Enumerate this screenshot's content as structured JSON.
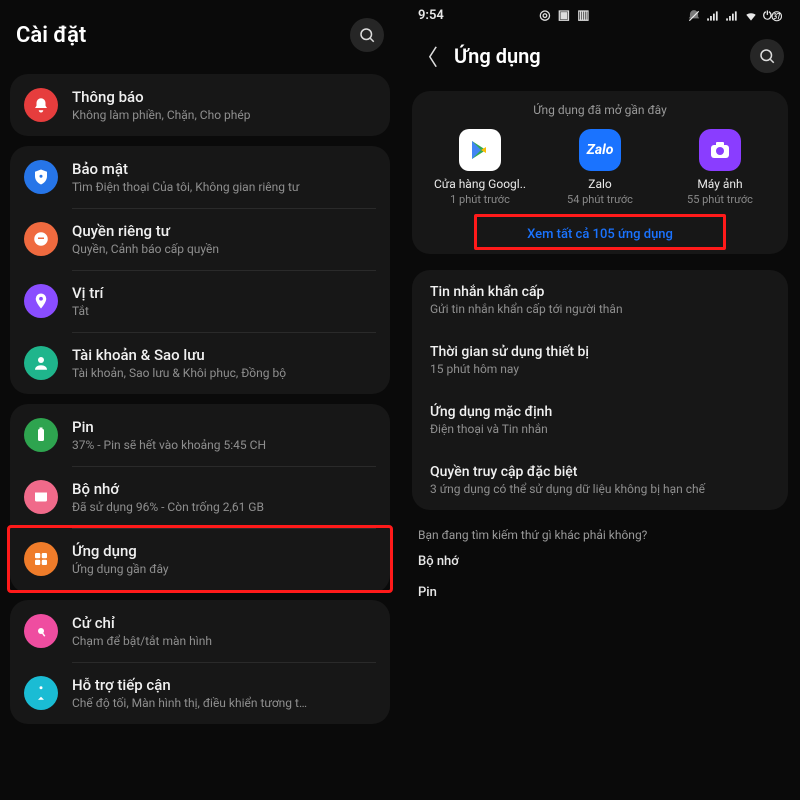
{
  "left": {
    "title": "Cài đặt",
    "groups": [
      {
        "items": [
          {
            "icon": "bell-icon",
            "bg": "bg-red",
            "title": "Thông báo",
            "sub": "Không làm phiền, Chặn, Cho phép"
          }
        ]
      },
      {
        "items": [
          {
            "icon": "shield-icon",
            "bg": "bg-blue",
            "title": "Bảo mật",
            "sub": "Tìm Điện thoại Của tôi, Không gian riêng tư"
          },
          {
            "icon": "hand-icon",
            "bg": "bg-orange",
            "title": "Quyền riêng tư",
            "sub": "Quyền, Cảnh báo cấp quyền"
          },
          {
            "icon": "pin-icon",
            "bg": "bg-purple",
            "title": "Vị trí",
            "sub": "Tắt"
          },
          {
            "icon": "person-icon",
            "bg": "bg-teal",
            "title": "Tài khoản & Sao lưu",
            "sub": "Tài khoản, Sao lưu & Khôi phục, Đồng bộ"
          }
        ]
      },
      {
        "items": [
          {
            "icon": "battery-icon",
            "bg": "bg-green",
            "title": "Pin",
            "sub": "37% - Pin sẽ hết vào khoảng 5:45 CH"
          },
          {
            "icon": "storage-icon",
            "bg": "bg-pink",
            "title": "Bộ nhớ",
            "sub": "Đã sử dụng 96% - Còn trống 2,61 GB"
          },
          {
            "icon": "apps-icon",
            "bg": "bg-or2",
            "title": "Ứng dụng",
            "sub": "Ứng dụng gần đây",
            "highlight": true
          }
        ]
      },
      {
        "items": [
          {
            "icon": "touch-icon",
            "bg": "bg-pink2",
            "title": "Cử chỉ",
            "sub": "Chạm để bật/tắt màn hình"
          },
          {
            "icon": "a11y-icon",
            "bg": "bg-cyan",
            "title": "Hỗ trợ tiếp cận",
            "sub": "Chế độ tối, Màn hình thị, điều khiển tương t…"
          }
        ]
      }
    ]
  },
  "right": {
    "status_time": "9:54",
    "title": "Ứng dụng",
    "recent_label": "Ứng dụng đã mở gần đây",
    "apps": [
      {
        "name": "Cửa hàng Googl..",
        "time": "1 phút trước",
        "ico": "play"
      },
      {
        "name": "Zalo",
        "time": "54 phút trước",
        "ico": "zalo"
      },
      {
        "name": "Máy ảnh",
        "time": "55 phút trước",
        "ico": "cam"
      }
    ],
    "all_link": "Xem tất cả 105 ứng dụng",
    "rows": [
      {
        "title": "Tin nhắn khẩn cấp",
        "sub": "Gửi tin nhắn khẩn cấp tới người thân"
      },
      {
        "title": "Thời gian sử dụng thiết bị",
        "sub": "15 phút hôm nay"
      },
      {
        "title": "Ứng dụng mặc định",
        "sub": "Điện thoại và Tin nhắn"
      },
      {
        "title": "Quyền truy cập đặc biệt",
        "sub": "3 ứng dụng có thể sử dụng dữ liệu không bị hạn chế"
      }
    ],
    "footer_q": "Bạn đang tìm kiếm thứ gì khác phải không?",
    "footer_links": [
      "Bộ nhớ",
      "Pin"
    ]
  }
}
